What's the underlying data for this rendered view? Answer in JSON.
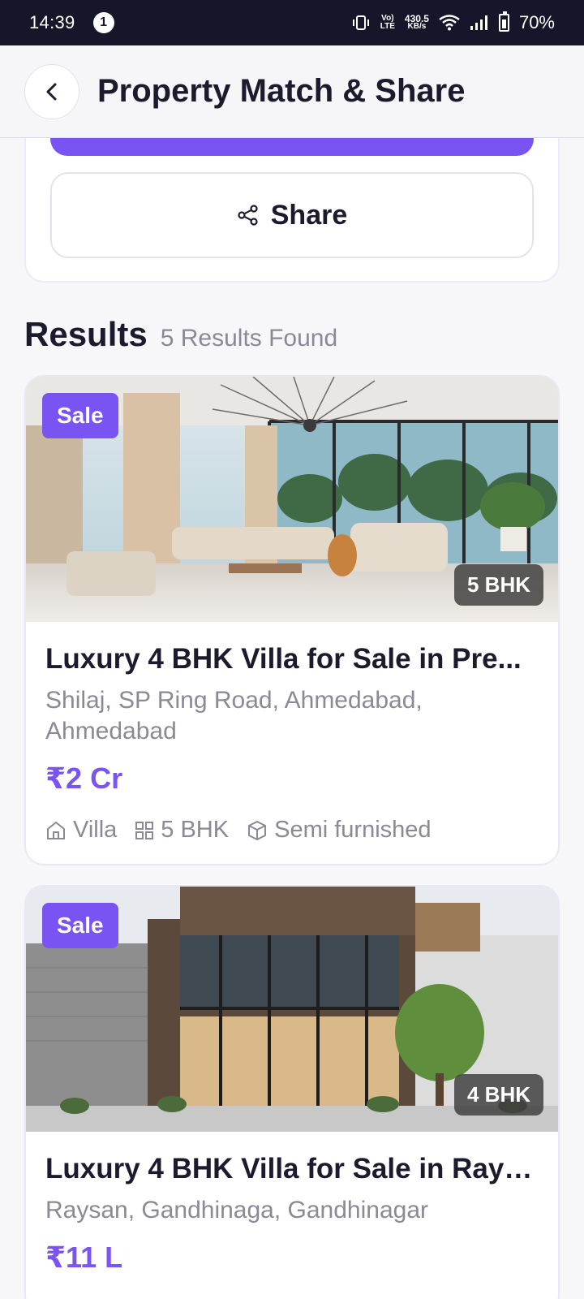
{
  "status_bar": {
    "time": "14:39",
    "notification_count": "1",
    "net_speed_value": "430.5",
    "net_speed_unit": "KB/s",
    "network_label_top": "Vo)",
    "network_label_bottom": "LTE",
    "battery": "70%"
  },
  "header": {
    "title": "Property Match & Share",
    "back_icon": "chevron-left-icon"
  },
  "actions": {
    "share_label": "Share",
    "share_icon": "share-icon"
  },
  "results": {
    "title": "Results",
    "count_text": "5 Results Found"
  },
  "properties": [
    {
      "badge": "Sale",
      "bhk_badge": "5 BHK",
      "title": "Luxury 4 BHK Villa for Sale in Pre...",
      "location": "Shilaj, SP Ring Road, Ahmedabad, Ahmedabad",
      "price": "₹2 Cr",
      "features": {
        "type": "Villa",
        "bhk": "5 BHK",
        "furnishing": "Semi furnished"
      }
    },
    {
      "badge": "Sale",
      "bhk_badge": "4 BHK",
      "title": "Luxury 4 BHK Villa for Sale in Rays...",
      "location": "Raysan, Gandhinaga, Gandhinagar",
      "price": "₹11 L"
    }
  ],
  "colors": {
    "accent": "#7a53f3",
    "status_bar_bg": "#16162a",
    "text_primary": "#1c1b2e",
    "text_secondary": "#8a8a96"
  }
}
